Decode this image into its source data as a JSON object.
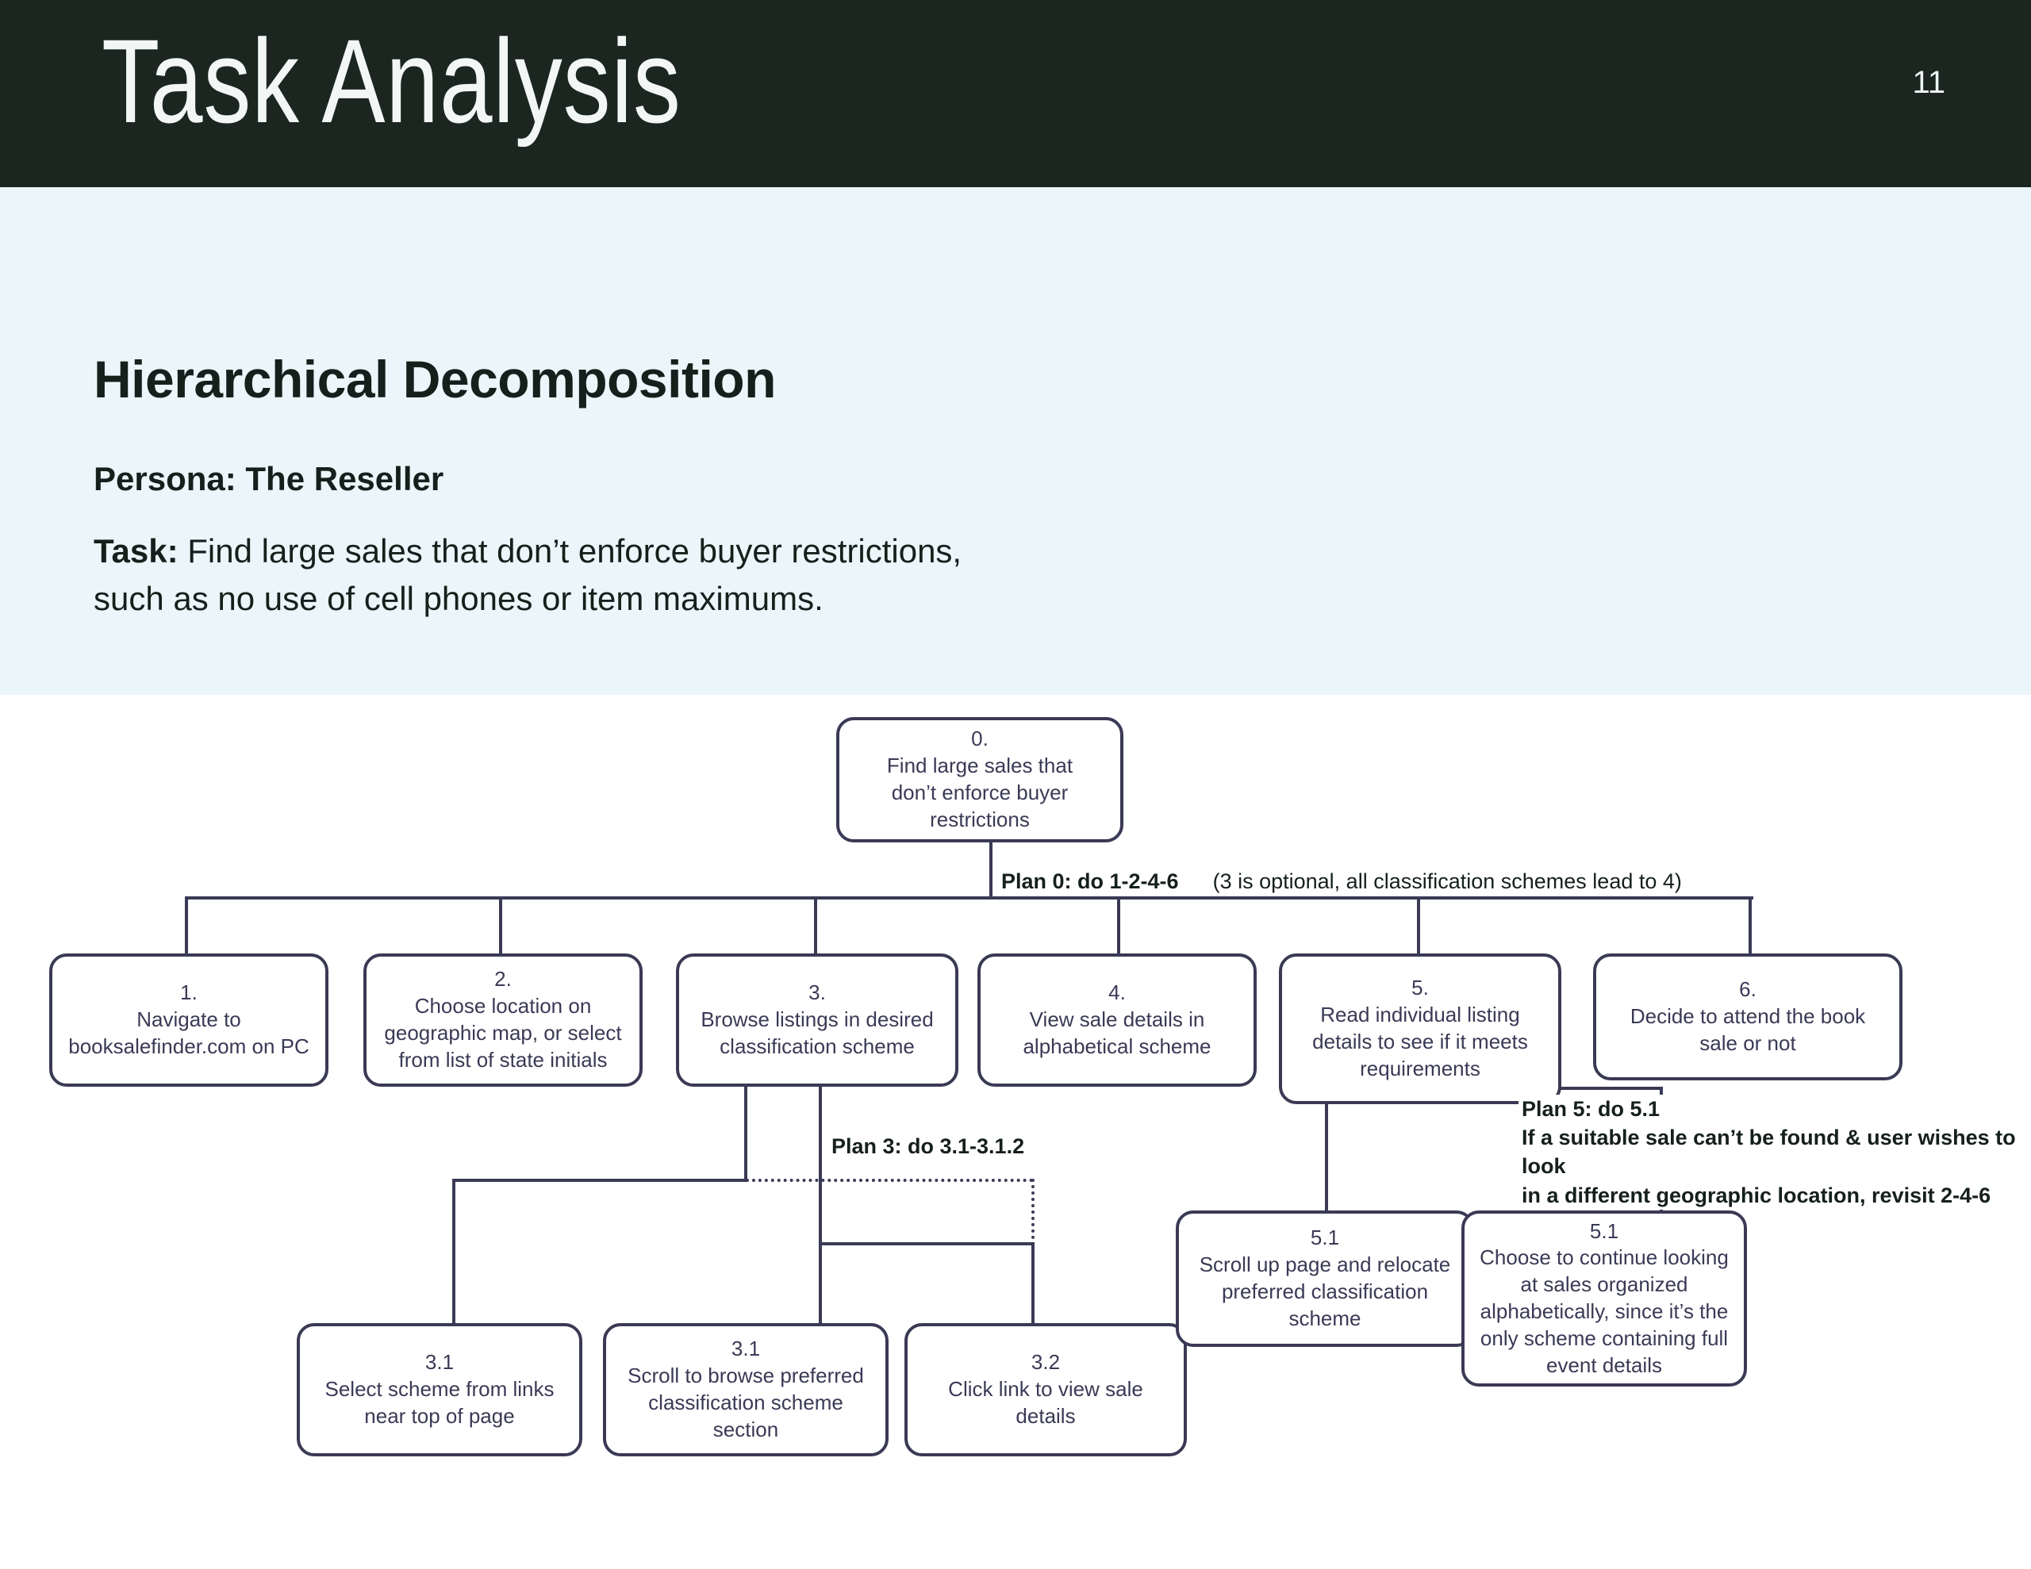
{
  "header": {
    "title": "Task Analysis",
    "page_number": "11"
  },
  "content": {
    "heading": "Hierarchical Decomposition",
    "persona_label": "Persona:",
    "persona_value": "The Reseller",
    "task_label": "Task:",
    "task_value": "Find large sales that don’t enforce buyer restrictions, such as no use of cell phones or item maximums."
  },
  "colors": {
    "header_bg": "#1b2620",
    "band_bg": "#eaf6f9",
    "node_stroke": "#3a3a56",
    "text_dark": "#15201c"
  },
  "chart_data": {
    "type": "diagram",
    "title": "Hierarchical Task Analysis — The Reseller",
    "nodes": [
      {
        "id": "0",
        "number": "0.",
        "text": "Find large sales that don’t enforce buyer restrictions",
        "level": 0
      },
      {
        "id": "1",
        "number": "1.",
        "text": "Navigate to booksalefinder.com on PC",
        "level": 1
      },
      {
        "id": "2",
        "number": "2.",
        "text": "Choose location on geographic map, or select from list of state initials",
        "level": 1
      },
      {
        "id": "3",
        "number": "3.",
        "text": "Browse listings in desired classification scheme",
        "level": 1
      },
      {
        "id": "4",
        "number": "4.",
        "text": "View sale details in alphabetical scheme",
        "level": 1
      },
      {
        "id": "5",
        "number": "5.",
        "text": "Read individual listing details to see if it meets requirements",
        "level": 1
      },
      {
        "id": "6",
        "number": "6.",
        "text": "Decide to attend the book sale or not",
        "level": 1
      },
      {
        "id": "3.1a",
        "number": "3.1",
        "text": "Select scheme from links near top of page",
        "level": 2
      },
      {
        "id": "3.1b",
        "number": "3.1",
        "text": "Scroll to browse preferred classification scheme section",
        "level": 2
      },
      {
        "id": "3.2",
        "number": "3.2",
        "text": "Click link to view sale details",
        "level": 2
      },
      {
        "id": "5.1a",
        "number": "5.1",
        "text": "Scroll up page and relocate preferred classification scheme",
        "level": 2
      },
      {
        "id": "5.1b",
        "number": "5.1",
        "text": "Choose to continue looking at sales organized alphabetically, since it’s the only scheme containing full event details",
        "level": 2
      }
    ],
    "plans": [
      {
        "id": "plan0",
        "strong": "Plan 0: do 1-2-4-6",
        "regular": "(3 is optional, all classification schemes lead to 4)"
      },
      {
        "id": "plan3",
        "strong": "Plan 3: do 3.1-3.1.2",
        "regular": ""
      },
      {
        "id": "plan5",
        "strong": "Plan 5: do 5.1\nIf a suitable sale can’t be found & user wishes to look in a different geographic location, revisit 2-4-6",
        "regular": ""
      }
    ],
    "plan5_lines": [
      "Plan 5: do 5.1",
      "If a suitable sale can’t be found & user wishes to look",
      "in a different geographic location, revisit 2-4-6"
    ],
    "edges": [
      {
        "from": "0",
        "to": "1"
      },
      {
        "from": "0",
        "to": "2"
      },
      {
        "from": "0",
        "to": "3"
      },
      {
        "from": "0",
        "to": "4"
      },
      {
        "from": "0",
        "to": "5"
      },
      {
        "from": "0",
        "to": "6"
      },
      {
        "from": "3",
        "to": "3.1a"
      },
      {
        "from": "3",
        "to": "3.1b"
      },
      {
        "from": "3",
        "to": "3.2"
      },
      {
        "from": "5",
        "to": "5.1a"
      },
      {
        "from": "5",
        "to": "5.1b"
      }
    ]
  },
  "node_text": {
    "n0_num": "0.",
    "n0_l1": "Find large sales that",
    "n0_l2": "don’t enforce buyer",
    "n0_l3": "restrictions",
    "n1_num": "1.",
    "n1_l1": "Navigate to",
    "n1_l2": "booksalefinder.com on PC",
    "n2_num": "2.",
    "n2_l1": "Choose location on",
    "n2_l2": "geographic map, or select",
    "n2_l3": "from list of state initials",
    "n3_num": "3.",
    "n3_l1": "Browse listings in desired",
    "n3_l2": "classification scheme",
    "n4_num": "4.",
    "n4_l1": "View sale details in",
    "n4_l2": "alphabetical scheme",
    "n5_num": "5.",
    "n5_l1": "Read individual listing",
    "n5_l2": "details to see if it meets",
    "n5_l3": "requirements",
    "n6_num": "6.",
    "n6_l1": "Decide to attend the book",
    "n6_l2": "sale or not",
    "n31a_num": "3.1",
    "n31a_l1": "Select scheme from links",
    "n31a_l2": "near top of page",
    "n31b_num": "3.1",
    "n31b_l1": "Scroll to browse preferred",
    "n31b_l2": "classification scheme",
    "n31b_l3": "section",
    "n32_num": "3.2",
    "n32_l1": "Click link to view sale",
    "n32_l2": "details",
    "n51a_num": "5.1",
    "n51a_l1": "Scroll up page and relocate",
    "n51a_l2": "preferred classification",
    "n51a_l3": "scheme",
    "n51b_num": "5.1",
    "n51b_l1": "Choose to continue looking",
    "n51b_l2": "at sales organized",
    "n51b_l3": "alphabetically, since it’s the",
    "n51b_l4": "only scheme containing full",
    "n51b_l5": "event details",
    "plan0_strong": "Plan 0: do 1-2-4-6",
    "plan0_reg": "(3 is optional, all classification schemes lead to 4)",
    "plan3_strong": "Plan 3: do 3.1-3.1.2",
    "plan5_l1": "Plan 5: do 5.1",
    "plan5_l2": "If a suitable sale can’t be found & user wishes to look",
    "plan5_l3": "in a different geographic location, revisit 2-4-6"
  }
}
